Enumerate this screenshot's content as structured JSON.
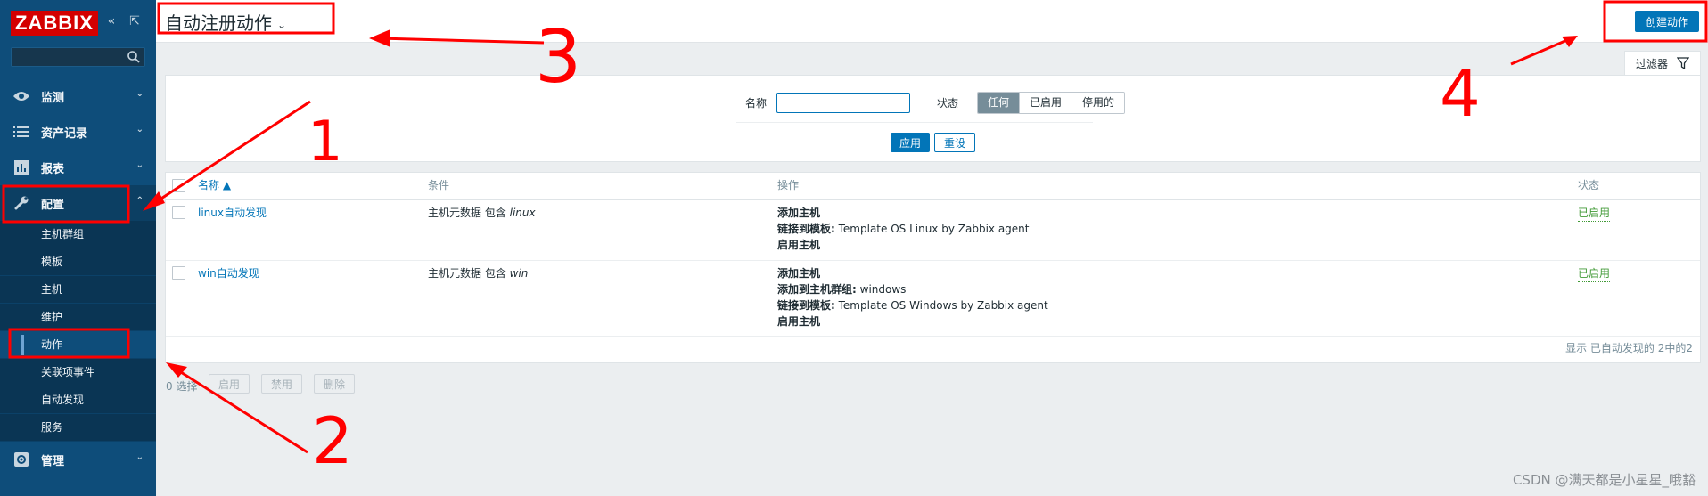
{
  "sidebar": {
    "logo": "ZABBIX",
    "search": {
      "value": "",
      "placeholder": ""
    },
    "menu": [
      {
        "label": "监测",
        "icon": "eye-icon"
      },
      {
        "label": "资产记录",
        "icon": "list-icon"
      },
      {
        "label": "报表",
        "icon": "bar-chart-icon"
      },
      {
        "label": "配置",
        "icon": "wrench-icon"
      },
      {
        "label": "管理",
        "icon": "gear-icon"
      }
    ],
    "submenu": [
      "主机群组",
      "模板",
      "主机",
      "维护",
      "动作",
      "关联项事件",
      "自动发现",
      "服务"
    ]
  },
  "header": {
    "title": "自动注册动作",
    "create_button": "创建动作"
  },
  "filter": {
    "tab_label": "过滤器",
    "name_label": "名称",
    "name_value": "",
    "status_label": "状态",
    "status_options": [
      "任何",
      "已启用",
      "停用的"
    ],
    "status_selected": "任何",
    "apply": "应用",
    "reset": "重设"
  },
  "table": {
    "columns": [
      "名称 ▲",
      "条件",
      "操作",
      "状态"
    ],
    "rows": [
      {
        "name": "linux自动发现",
        "condition_prefix": "主机元数据 包含 ",
        "condition_value": "linux",
        "op1": "添加主机",
        "op2_label": "链接到模板:",
        "op2_value": " Template OS Linux by Zabbix agent",
        "op3": "启用主机",
        "status": "已启用"
      },
      {
        "name": "win自动发现",
        "condition_prefix": "主机元数据 包含 ",
        "condition_value": "win",
        "op1": "添加主机",
        "op2_label": "添加到主机群组:",
        "op2_value": " windows",
        "op3_label": "链接到模板:",
        "op3_value": " Template OS Windows by Zabbix agent",
        "op4": "启用主机",
        "status": "已启用"
      }
    ],
    "footer": "显示 已自动发现的 2中的2"
  },
  "bulk": {
    "selected": "0 选择",
    "enable": "启用",
    "disable": "禁用",
    "delete": "删除"
  },
  "annotations": [
    "1",
    "2",
    "3",
    "4"
  ],
  "watermark": "CSDN @满天都是小星星_哦豁",
  "colors": {
    "sidebar": "#0e4d7a",
    "accent": "#0275b8",
    "enabled": "#429a37",
    "annotation": "#ff0000"
  }
}
